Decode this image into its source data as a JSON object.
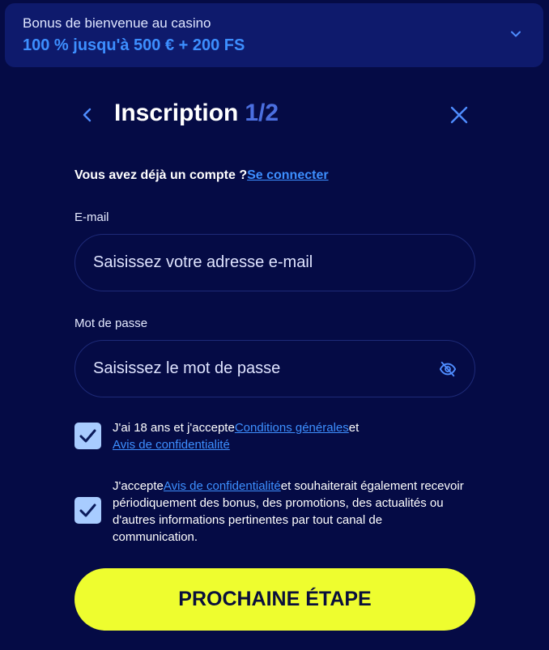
{
  "bonus": {
    "title": "Bonus de bienvenue au casino",
    "amount": "100 % jusqu'à 500 € + 200 FS",
    "chevron_icon": "chevron-down-icon"
  },
  "header": {
    "title": "Inscription",
    "step": "1/2",
    "back_icon": "chevron-left-icon",
    "close_icon": "close-icon"
  },
  "login": {
    "prompt": "Vous avez déjà un compte ?",
    "link": "Se connecter"
  },
  "form": {
    "email": {
      "label": "E-mail",
      "placeholder": "Saisissez votre adresse e-mail",
      "value": ""
    },
    "password": {
      "label": "Mot de passe",
      "placeholder": "Saisissez le mot de passe",
      "value": "",
      "toggle_icon": "eye-slash-icon"
    }
  },
  "consents": [
    {
      "checked": true,
      "text_before": "J'ai 18 ans et j'accepte",
      "link1": "Conditions générales",
      "text_middle": "et",
      "link2": "Avis de confidentialité"
    },
    {
      "checked": true,
      "text_before": "J'accepte",
      "link": "Avis de confidentialité",
      "text_after": "et souhaiterait également recevoir périodiquement des bonus, des promotions, des actualités ou d'autres informations pertinentes par tout canal de communication."
    }
  ],
  "next_button": {
    "label": "PROCHAINE ÉTAPE"
  },
  "colors": {
    "background": "#050b45",
    "banner": "#0e1a6c",
    "accent_blue": "#3d8fff",
    "step_blue": "#4b6fe0",
    "checkbox": "#a8ccff",
    "button_yellow": "#eefd2f"
  }
}
